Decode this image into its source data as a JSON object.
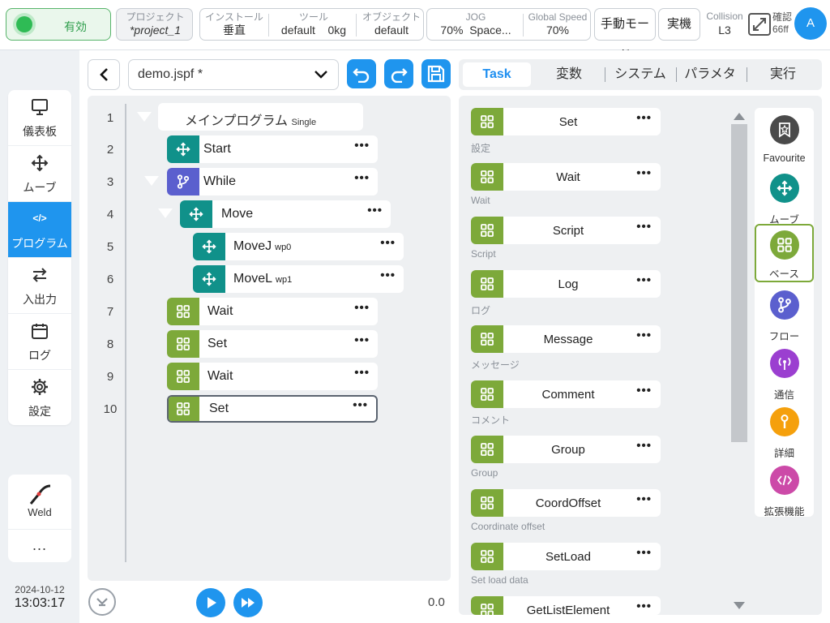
{
  "topbar": {
    "enable_label": "有効",
    "project": {
      "title": "プロジェクト",
      "value": "*project_1"
    },
    "install": {
      "title": "インストール",
      "value": "垂直"
    },
    "tool": {
      "title": "ツール",
      "value": "default",
      "weight": "0kg"
    },
    "object": {
      "title": "オブジェクト",
      "value": "default"
    },
    "jog": {
      "title": "JOG",
      "percent": "70%",
      "space": "Space..."
    },
    "global_speed": {
      "title": "Global Speed",
      "value": "70%"
    },
    "mode_label": "手動モード",
    "real_label": "実機",
    "collision": {
      "title": "Collision",
      "value": "L3"
    },
    "confirm": {
      "line1": "確認",
      "line2": "66ff"
    },
    "avatar": "A"
  },
  "leftnav": {
    "items": [
      {
        "label": "儀表板",
        "icon": "monitor-icon"
      },
      {
        "label": "ムーブ",
        "icon": "move-icon"
      },
      {
        "label": "プログラム",
        "icon": "code-icon",
        "code": "</>"
      },
      {
        "label": "入出力",
        "icon": "swap-icon"
      },
      {
        "label": "ログ",
        "icon": "calendar-icon"
      },
      {
        "label": "設定",
        "icon": "gear-icon"
      }
    ],
    "weld_label": "Weld",
    "more_label": "..."
  },
  "datetime": {
    "date": "2024-10-12",
    "time": "13:03:17"
  },
  "editor": {
    "filename": "demo.jspf *",
    "tree": {
      "line_numbers": [
        "1",
        "2",
        "3",
        "4",
        "5",
        "6",
        "7",
        "8",
        "9",
        "10"
      ],
      "main": {
        "label": "メインプログラム",
        "sub": "Single"
      },
      "nodes": [
        {
          "label": "Start",
          "sub": ""
        },
        {
          "label": "While",
          "sub": ""
        },
        {
          "label": "Move",
          "sub": ""
        },
        {
          "label": "MoveJ",
          "sub": "wp0"
        },
        {
          "label": "MoveL",
          "sub": "wp1"
        },
        {
          "label": "Wait",
          "sub": ""
        },
        {
          "label": "Set",
          "sub": ""
        },
        {
          "label": "Wait",
          "sub": ""
        },
        {
          "label": "Set",
          "sub": ""
        }
      ],
      "more": "•••"
    },
    "progress": "0.0"
  },
  "tabs": [
    "Task",
    "変数",
    "システム",
    "パラメタ",
    "実行"
  ],
  "palette": {
    "blocks": [
      {
        "label": "Set",
        "desc": "設定"
      },
      {
        "label": "Wait",
        "desc": "Wait"
      },
      {
        "label": "Script",
        "desc": "Script"
      },
      {
        "label": "Log",
        "desc": "ログ"
      },
      {
        "label": "Message",
        "desc": "メッセージ"
      },
      {
        "label": "Comment",
        "desc": "コメント"
      },
      {
        "label": "Group",
        "desc": "Group"
      },
      {
        "label": "CoordOffset",
        "desc": "Coordinate offset"
      },
      {
        "label": "SetLoad",
        "desc": "Set load data"
      },
      {
        "label": "GetListElement",
        "desc": ""
      }
    ],
    "more": "•••"
  },
  "categories": [
    {
      "label": "Favourite",
      "icon": "bookmark-icon",
      "color": "#4a4a4a"
    },
    {
      "label": "ムーブ",
      "icon": "move-icon",
      "color": "#10918a"
    },
    {
      "label": "ベース",
      "icon": "grid-icon",
      "color": "#7da93a"
    },
    {
      "label": "フロー",
      "icon": "branch-icon",
      "color": "#5b5fce"
    },
    {
      "label": "通信",
      "icon": "antenna-icon",
      "color": "#9b3fd0"
    },
    {
      "label": "詳細",
      "icon": "wrench-icon",
      "color": "#f5a00c"
    },
    {
      "label": "拡張機能",
      "icon": "code-icon",
      "color": "#cc4aa8"
    }
  ],
  "colors": {
    "accent": "#1f95ee",
    "teal": "#10918a",
    "purple": "#5b5fce",
    "green": "#7da93a",
    "enable": "#2fbb55"
  }
}
